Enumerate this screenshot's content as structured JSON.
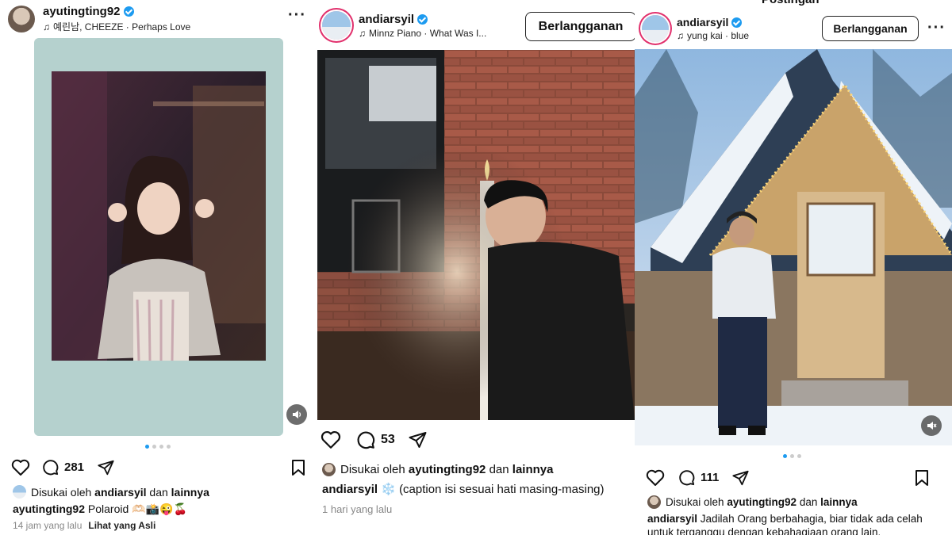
{
  "panels": [
    {
      "username": "ayutingting92",
      "song_artist": "예린남, CHEEZE",
      "song_title": "Perhaps Love",
      "likes_count": "",
      "comments_count": "281",
      "liked_prefix": "Disukai oleh",
      "liked_user": "andiarsyil",
      "liked_and": "dan",
      "liked_others": "lainnya",
      "caption_user": "ayutingting92",
      "caption_text": "Polaroid 🫶🏻📸😜🍒",
      "time": "14 jam yang lalu",
      "see_original": "Lihat yang Asli",
      "carousel_count": 4,
      "carousel_index": 0
    },
    {
      "username": "andiarsyil",
      "song_artist": "Minnz Piano",
      "song_title": "What Was I...",
      "subscribe_label": "Berlangganan",
      "comments_count": "53",
      "liked_prefix": "Disukai oleh",
      "liked_user": "ayutingting92",
      "liked_and": "dan",
      "liked_others": "lainnya",
      "caption_user": "andiarsyil",
      "caption_text": "❄️ (caption isi sesuai hati masing-masing)",
      "time": "1 hari yang lalu"
    },
    {
      "page_title": "Postingan",
      "username": "andiarsyil",
      "song_artist": "yung kai",
      "song_title": "blue",
      "subscribe_label": "Berlangganan",
      "comments_count": "111",
      "liked_prefix": "Disukai oleh",
      "liked_user": "ayutingting92",
      "liked_and": "dan",
      "liked_others": "lainnya",
      "caption_user": "andiarsyil",
      "caption_text": "Jadilah Orang berbahagia, biar tidak ada celah untuk terganggu dengan kebahagiaan orang lain.",
      "carousel_count": 3,
      "carousel_index": 0
    }
  ],
  "icons": {
    "like": "heart-icon",
    "comment": "comment-icon",
    "share": "paper-plane-icon",
    "save": "bookmark-icon",
    "more": "more-options-icon",
    "audio": "speaker-icon",
    "verified": "verified-badge-icon"
  },
  "colors": {
    "verified": "#1d9bf0",
    "active_dot": "#1d9bf0",
    "polaroid_frame": "#a9c9c6"
  }
}
